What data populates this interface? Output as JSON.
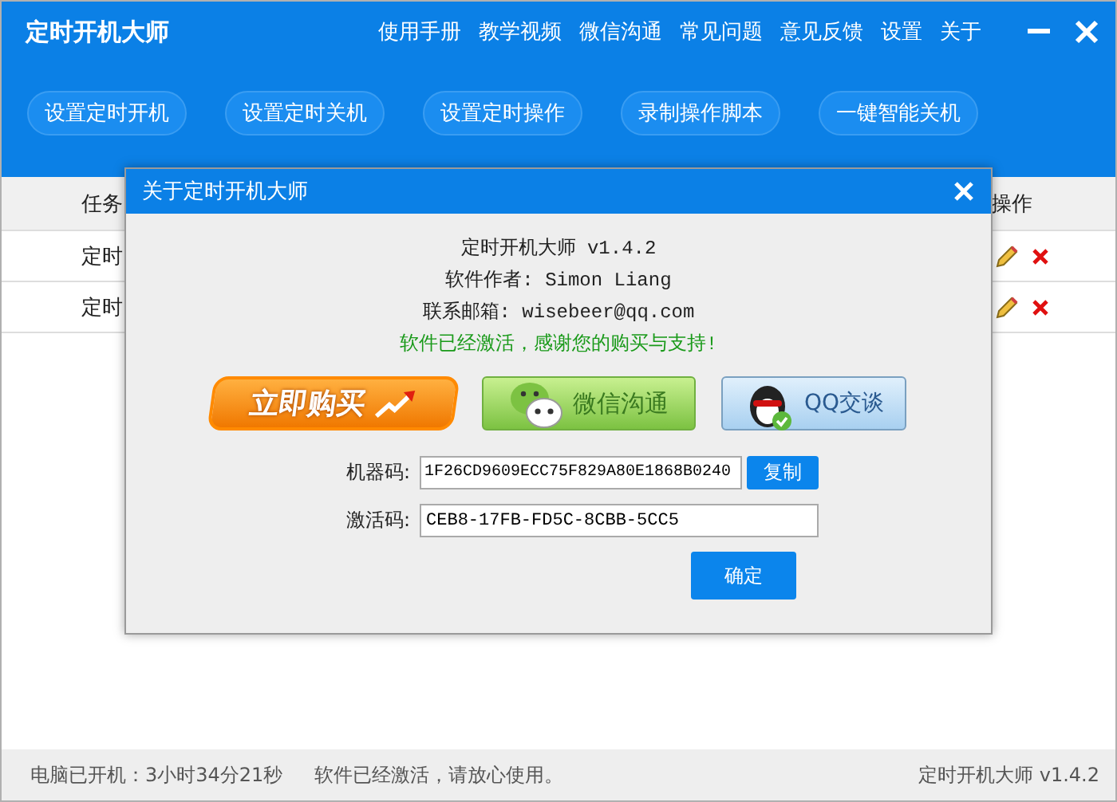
{
  "window": {
    "title": "定时开机大师",
    "menu": [
      "使用手册",
      "教学视频",
      "微信沟通",
      "常见问题",
      "意见反馈",
      "设置",
      "关于"
    ]
  },
  "toolbar": [
    "设置定时开机",
    "设置定时关机",
    "设置定时操作",
    "录制操作脚本",
    "一键智能关机"
  ],
  "table": {
    "columns": [
      "任务",
      "操作"
    ],
    "rows": [
      {
        "name": "定时"
      },
      {
        "name": "定时"
      }
    ]
  },
  "dialog": {
    "title": "关于定时开机大师",
    "lines": [
      {
        "kind": "plain",
        "text": "定时开机大师 v1.4.2"
      },
      {
        "kind": "plain",
        "text": "软件作者: Simon Liang"
      },
      {
        "kind": "plain",
        "text": "联系邮箱: wisebeer@qq.com"
      },
      {
        "kind": "success",
        "text": "软件已经激活，感谢您的购买与支持!"
      }
    ],
    "promos": [
      {
        "kind": "buy",
        "label": "立即购买"
      },
      {
        "kind": "wechat",
        "label": "微信沟通"
      },
      {
        "kind": "qq",
        "label": "QQ交谈"
      }
    ],
    "machine_code": {
      "label": "机器码:",
      "value": "1F26CD9609ECC75F829A80E1868B0240",
      "button": "复制"
    },
    "activation_code": {
      "label": "激活码:",
      "value": "CEB8-17FB-FD5C-8CBB-5CC5"
    },
    "ok_button": "确定"
  },
  "status_bar": {
    "uptime": "电脑已开机：3小时34分21秒",
    "message": "软件已经激活，请放心使用。",
    "version": "定时开机大师 v1.4.2"
  }
}
